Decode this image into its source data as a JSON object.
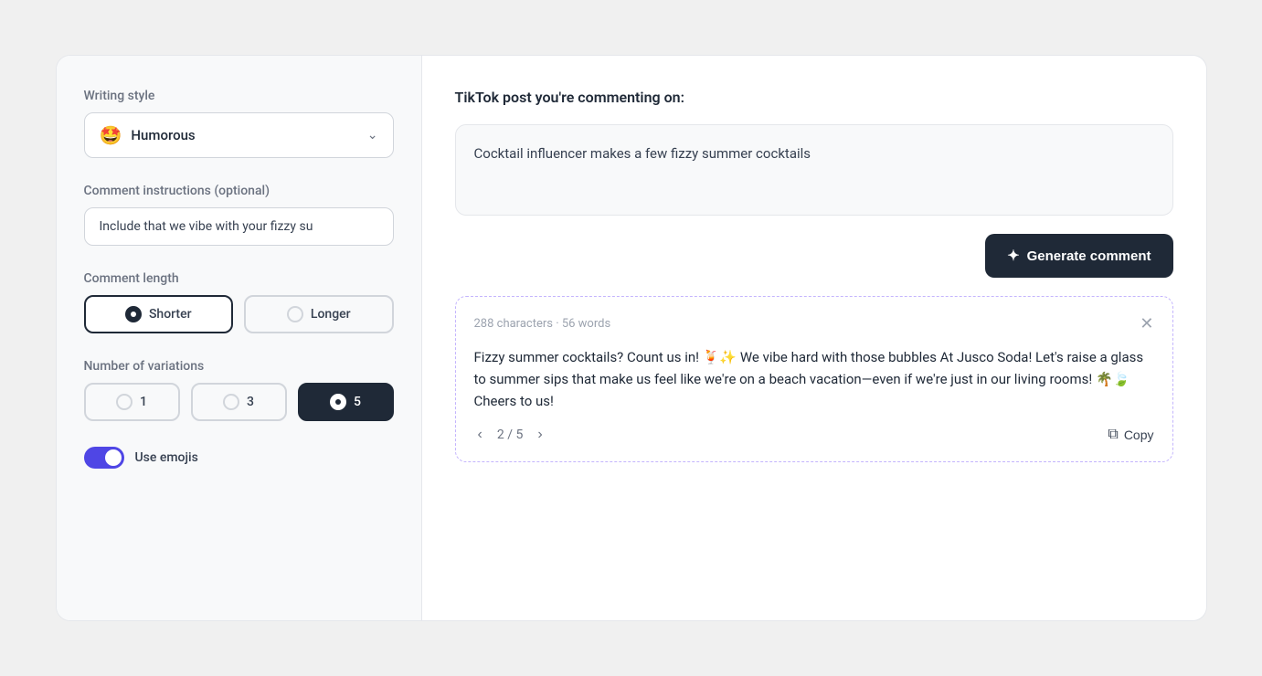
{
  "left_panel": {
    "writing_style_label": "Writing style",
    "writing_style_emoji": "🤩",
    "writing_style_value": "Humorous",
    "comment_instructions_label": "Comment instructions (optional)",
    "comment_instructions_placeholder": "Include that we vibe with your fizzy su",
    "comment_length_label": "Comment length",
    "length_options": [
      {
        "id": "shorter",
        "label": "Shorter",
        "selected": true
      },
      {
        "id": "longer",
        "label": "Longer",
        "selected": false
      }
    ],
    "variations_label": "Number of variations",
    "variation_options": [
      {
        "id": "1",
        "label": "1",
        "selected": false
      },
      {
        "id": "3",
        "label": "3",
        "selected": false
      },
      {
        "id": "5",
        "label": "5",
        "selected": true
      }
    ],
    "use_emojis_label": "Use emojis",
    "use_emojis_enabled": true
  },
  "right_panel": {
    "tiktok_label": "TikTok post you're commenting on:",
    "tiktok_post_text": "Cocktail influencer makes a few fizzy summer cocktails",
    "generate_button_label": "Generate comment",
    "result": {
      "meta": "288 characters · 56 words",
      "text": "Fizzy summer cocktails? Count us in! 🍹✨ We vibe hard with those bubbles At Jusco Soda! Let's raise a glass to summer sips that make us feel like we're on a beach vacation—even if we're just in our living rooms! 🌴🍃 Cheers to us!",
      "current_page": "2",
      "total_pages": "5",
      "copy_label": "Copy"
    }
  }
}
